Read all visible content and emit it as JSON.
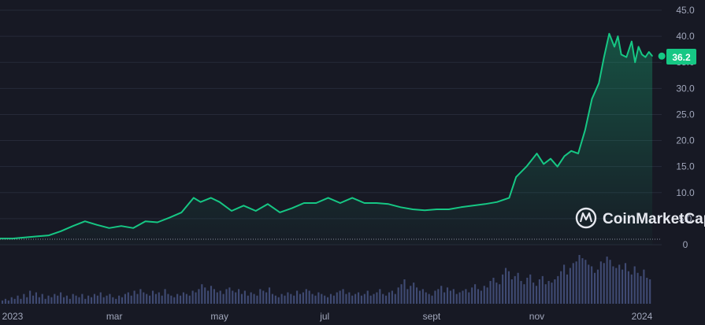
{
  "chart_data": {
    "type": "area",
    "title": "",
    "xlabel": "",
    "ylabel": "",
    "ylim": [
      0,
      45
    ],
    "grid": true,
    "y_ticks": [
      "45.0",
      "40.0",
      "35.0",
      "30.0",
      "25.0",
      "20.0",
      "15.0",
      "10.0",
      "5.0",
      "0"
    ],
    "x_ticks": [
      {
        "label": "2023",
        "x": "2023-01-01"
      },
      {
        "label": "mar",
        "x": "2023-03-01"
      },
      {
        "label": "may",
        "x": "2023-05-01"
      },
      {
        "label": "jul",
        "x": "2023-07-01"
      },
      {
        "label": "sept",
        "x": "2023-09-01"
      },
      {
        "label": "nov",
        "x": "2023-11-01"
      },
      {
        "label": "2024",
        "x": "2024-01-01"
      }
    ],
    "current_value": "36.2",
    "colors": {
      "line": "#16c784",
      "badge": "#16c784",
      "volume": "#3f4a72"
    },
    "series": [
      {
        "x": [
          "2023-01-01",
          "2023-01-08",
          "2023-01-15",
          "2023-01-22",
          "2023-01-29",
          "2023-02-05",
          "2023-02-12",
          "2023-02-19",
          "2023-02-26",
          "2023-03-05",
          "2023-03-12",
          "2023-03-19",
          "2023-03-26",
          "2023-04-02",
          "2023-04-09",
          "2023-04-16",
          "2023-04-20",
          "2023-04-26",
          "2023-05-01",
          "2023-05-08",
          "2023-05-15",
          "2023-05-22",
          "2023-05-29",
          "2023-06-05",
          "2023-06-12",
          "2023-06-19",
          "2023-06-26",
          "2023-07-03",
          "2023-07-10",
          "2023-07-17",
          "2023-07-24",
          "2023-07-31",
          "2023-08-07",
          "2023-08-14",
          "2023-08-21",
          "2023-08-28",
          "2023-09-04",
          "2023-09-11",
          "2023-09-18",
          "2023-09-25",
          "2023-10-02",
          "2023-10-09",
          "2023-10-16",
          "2023-10-20",
          "2023-10-26",
          "2023-11-01",
          "2023-11-05",
          "2023-11-09",
          "2023-11-13",
          "2023-11-17",
          "2023-11-21",
          "2023-11-25",
          "2023-11-29",
          "2023-12-03",
          "2023-12-07",
          "2023-12-10",
          "2023-12-13",
          "2023-12-16",
          "2023-12-18",
          "2023-12-20",
          "2023-12-23",
          "2023-12-26",
          "2023-12-28",
          "2023-12-30",
          "2024-01-01",
          "2024-01-03",
          "2024-01-05",
          "2024-01-07"
        ],
        "values": [
          1.2,
          1.4,
          1.6,
          1.8,
          2.6,
          3.6,
          4.5,
          3.8,
          3.2,
          3.6,
          3.2,
          4.5,
          4.3,
          5.2,
          6.2,
          9.0,
          8.2,
          9.0,
          8.2,
          6.5,
          7.5,
          6.5,
          7.8,
          6.2,
          7.0,
          8.0,
          8.0,
          9.0,
          8.0,
          9.0,
          8.0,
          8.0,
          7.8,
          7.2,
          6.8,
          6.6,
          6.8,
          6.8,
          7.2,
          7.5,
          7.8,
          8.2,
          9.0,
          13.0,
          15.0,
          17.5,
          15.5,
          16.5,
          15.0,
          17.0,
          18.0,
          17.5,
          22.0,
          28.0,
          31.0,
          36.0,
          40.5,
          38.0,
          40.0,
          36.5,
          36.0,
          39.0,
          35.0,
          38.0,
          36.5,
          36.0,
          37.0,
          36.2
        ]
      }
    ],
    "volume": [
      2,
      3,
      2,
      4,
      3,
      5,
      3,
      6,
      4,
      8,
      5,
      7,
      4,
      6,
      3,
      5,
      4,
      6,
      5,
      7,
      4,
      5,
      3,
      6,
      5,
      4,
      6,
      3,
      5,
      4,
      6,
      5,
      7,
      4,
      5,
      6,
      4,
      3,
      5,
      4,
      6,
      7,
      5,
      8,
      6,
      9,
      7,
      6,
      5,
      8,
      6,
      7,
      5,
      9,
      6,
      5,
      4,
      6,
      5,
      7,
      6,
      5,
      8,
      7,
      9,
      12,
      10,
      8,
      11,
      9,
      7,
      8,
      6,
      9,
      10,
      8,
      7,
      9,
      6,
      8,
      5,
      7,
      6,
      5,
      9,
      8,
      7,
      10,
      6,
      5,
      4,
      6,
      5,
      7,
      6,
      5,
      8,
      6,
      7,
      9,
      8,
      6,
      5,
      7,
      6,
      5,
      4,
      6,
      5,
      7,
      8,
      9,
      6,
      7,
      5,
      6,
      7,
      5,
      6,
      8,
      5,
      6,
      7,
      9,
      6,
      5,
      7,
      8,
      6,
      10,
      12,
      15,
      9,
      11,
      13,
      10,
      8,
      9,
      7,
      6,
      5,
      8,
      9,
      11,
      7,
      10,
      8,
      9,
      6,
      7,
      8,
      9,
      7,
      10,
      12,
      9,
      8,
      11,
      10,
      14,
      16,
      13,
      12,
      18,
      22,
      20,
      15,
      17,
      19,
      14,
      12,
      16,
      18,
      13,
      11,
      15,
      17,
      12,
      14,
      13,
      15,
      17,
      20,
      24,
      18,
      22,
      25,
      26,
      30,
      28,
      27,
      24,
      23,
      19,
      21,
      26,
      25,
      29,
      27,
      23,
      22,
      24,
      21,
      25,
      20,
      18,
      23,
      19,
      17,
      21,
      16,
      15
    ]
  },
  "watermark": {
    "text": "CoinMarketCap",
    "icon": "coinmarketcap-logo-icon"
  }
}
